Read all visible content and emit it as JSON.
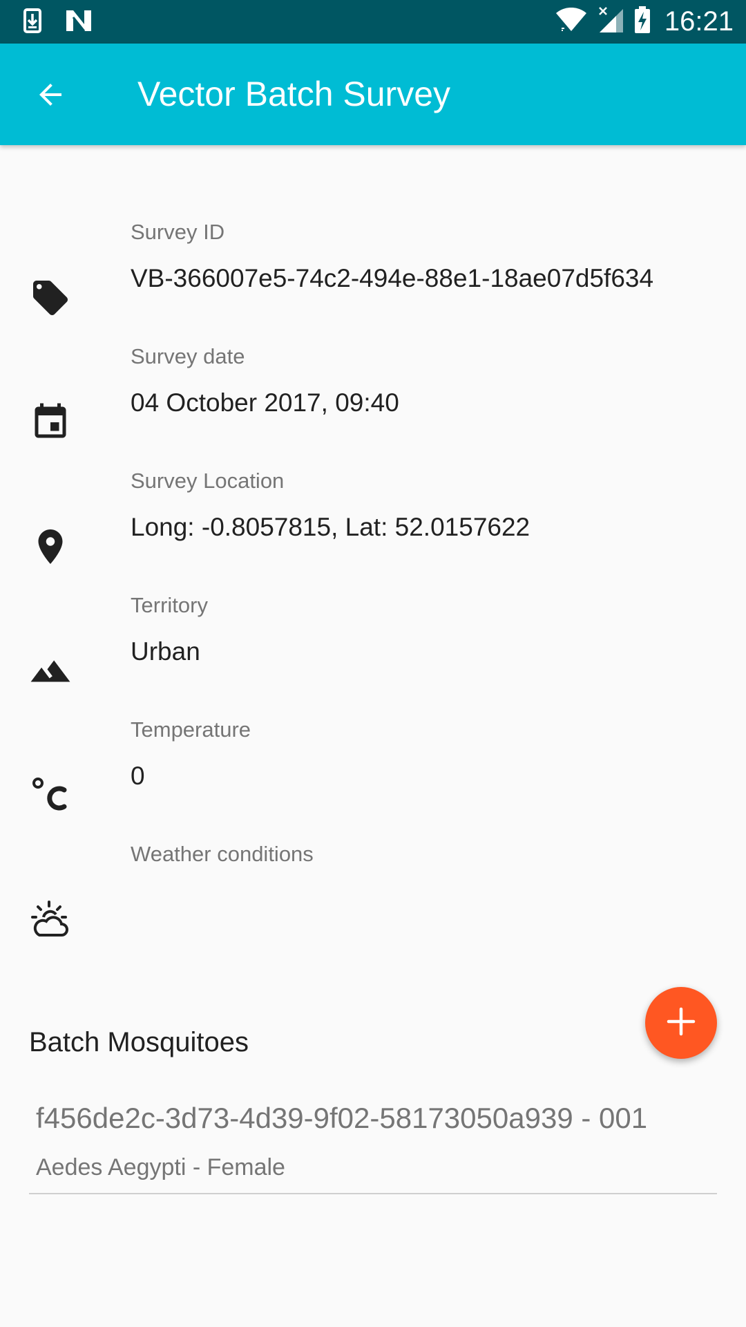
{
  "status_bar": {
    "time": "16:21",
    "left_icons": [
      "download-notification-icon",
      "n-notification-icon"
    ],
    "right_icons": [
      "wifi-icon",
      "cell-signal-icon",
      "battery-charging-icon"
    ]
  },
  "app_bar": {
    "title": "Vector Batch Survey",
    "back_icon": "arrow-back-icon",
    "background_color": "#00bcd4",
    "status_bar_color": "#005662"
  },
  "fields": [
    {
      "icon": "tag-icon",
      "label": "Survey ID",
      "value": "VB-366007e5-74c2-494e-88e1-18ae07d5f634"
    },
    {
      "icon": "calendar-icon",
      "label": "Survey date",
      "value": "04 October 2017, 09:40"
    },
    {
      "icon": "location-pin-icon",
      "label": "Survey Location",
      "value": "Long: -0.8057815, Lat: 52.0157622"
    },
    {
      "icon": "terrain-icon",
      "label": "Territory",
      "value": "Urban"
    },
    {
      "icon": "celsius-icon",
      "label": "Temperature",
      "value": "0"
    },
    {
      "icon": "weather-icon",
      "label": "Weather conditions",
      "value": ""
    }
  ],
  "batch": {
    "title": "Batch Mosquitoes",
    "fab_icon": "plus-icon",
    "fab_color": "#ff5722",
    "items": [
      {
        "title": "f456de2c-3d73-4d39-9f02-58173050a939 - 001",
        "subtitle": "Aedes Aegypti - Female"
      }
    ]
  }
}
